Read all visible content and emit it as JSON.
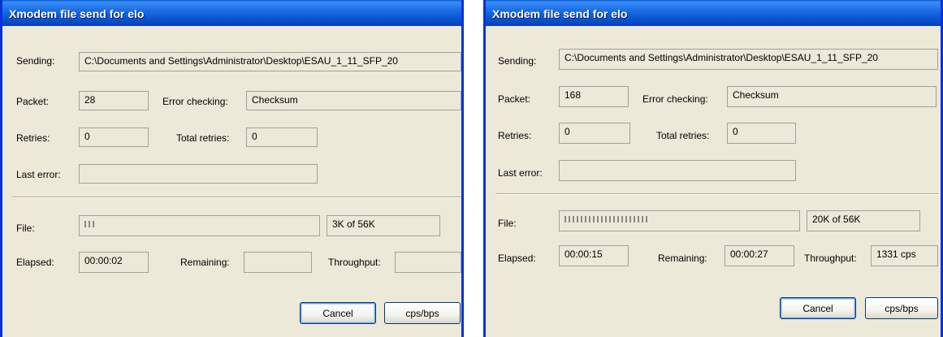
{
  "dialogs": [
    {
      "title": "Xmodem file send for elo",
      "labels": {
        "sending": "Sending:",
        "packet": "Packet:",
        "error_checking": "Error checking:",
        "retries": "Retries:",
        "total_retries": "Total retries:",
        "last_error": "Last error:",
        "file": "File:",
        "elapsed": "Elapsed:",
        "remaining": "Remaining:",
        "throughput": "Throughput:"
      },
      "sending": "C:\\Documents and Settings\\Administrator\\Desktop\\ESAU_1_11_SFP_20",
      "packet": "28",
      "error_checking": "Checksum",
      "retries": "0",
      "total_retries": "0",
      "last_error": "",
      "file_progress_fraction": 0.05,
      "file_size": "3K of 56K",
      "elapsed": "00:00:02",
      "remaining": "",
      "throughput": "",
      "buttons": {
        "cancel": "Cancel",
        "cps_bps": "cps/bps"
      }
    },
    {
      "title": "Xmodem file send for elo",
      "labels": {
        "sending": "Sending:",
        "packet": "Packet:",
        "error_checking": "Error checking:",
        "retries": "Retries:",
        "total_retries": "Total retries:",
        "last_error": "Last error:",
        "file": "File:",
        "elapsed": "Elapsed:",
        "remaining": "Remaining:",
        "throughput": "Throughput:"
      },
      "sending": "C:\\Documents and Settings\\Administrator\\Desktop\\ESAU_1_11_SFP_20",
      "packet": "168",
      "error_checking": "Checksum",
      "retries": "0",
      "total_retries": "0",
      "last_error": "",
      "file_progress_fraction": 0.36,
      "file_size": "20K of 56K",
      "elapsed": "00:00:15",
      "remaining": "00:00:27",
      "throughput": "1331 cps",
      "buttons": {
        "cancel": "Cancel",
        "cps_bps": "cps/bps"
      }
    }
  ]
}
